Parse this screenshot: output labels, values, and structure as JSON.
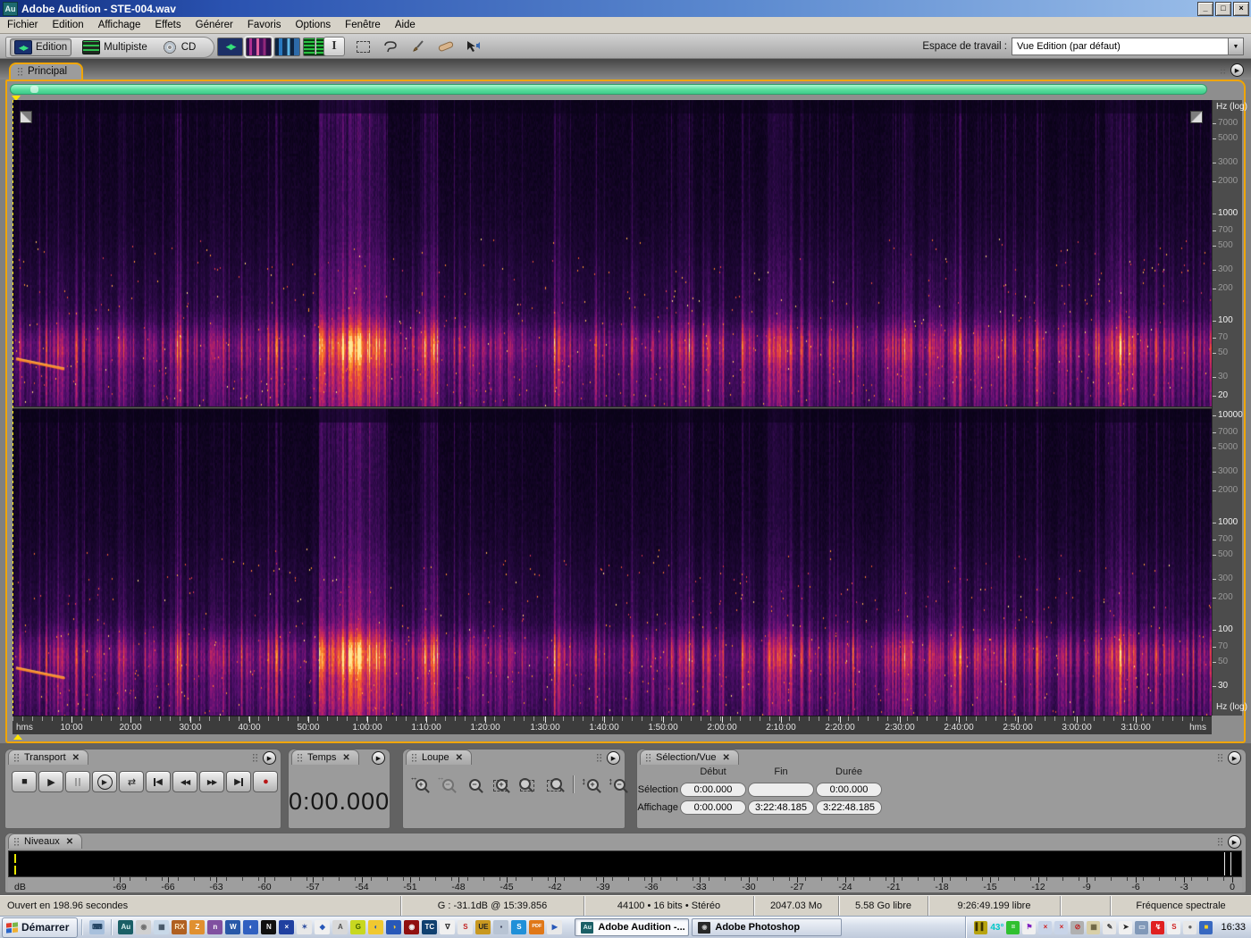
{
  "window": {
    "title": "Adobe Audition - STE-004.wav",
    "app_icon": "Au",
    "controls": {
      "minimize": "_",
      "restore": "□",
      "close": "×"
    }
  },
  "menu": {
    "items": [
      "Fichier",
      "Edition",
      "Affichage",
      "Effets",
      "Générer",
      "Favoris",
      "Options",
      "Fenêtre",
      "Aide"
    ]
  },
  "toolbar": {
    "modes": [
      {
        "label": "Edition",
        "icon": "edition-view-icon",
        "active": true
      },
      {
        "label": "Multipiste",
        "icon": "multitrack-view-icon",
        "active": false
      },
      {
        "label": "CD",
        "icon": "cd-view-icon",
        "active": false
      }
    ],
    "views": [
      {
        "name": "waveform-view",
        "active": false
      },
      {
        "name": "spectral-view",
        "active": true
      },
      {
        "name": "spectral-pan-view",
        "active": false
      },
      {
        "name": "phase-view",
        "active": false
      }
    ],
    "tools": [
      {
        "name": "time-selection-tool",
        "active": true
      },
      {
        "name": "marquee-selection-tool",
        "active": false
      },
      {
        "name": "lasso-selection-tool",
        "active": false
      },
      {
        "name": "effects-paintbrush-tool",
        "active": false
      },
      {
        "name": "spot-healing-brush-tool",
        "active": false
      },
      {
        "name": "scrub-tool",
        "active": false
      }
    ],
    "workspace_label": "Espace de travail :",
    "workspace_value": "Vue Edition (par défaut)",
    "workspace_dropdown_icon": "▼"
  },
  "tab": {
    "label": "Principal"
  },
  "spectro": {
    "freq_axis": {
      "unit_label": "Hz (log)",
      "ch1_ticks": [
        {
          "label": "7000",
          "f": 7000,
          "bold": false
        },
        {
          "label": "5000",
          "f": 5000,
          "bold": false
        },
        {
          "label": "3000",
          "f": 3000,
          "bold": false
        },
        {
          "label": "2000",
          "f": 2000,
          "bold": false
        },
        {
          "label": "1000",
          "f": 1000,
          "bold": true
        },
        {
          "label": "700",
          "f": 700,
          "bold": false
        },
        {
          "label": "500",
          "f": 500,
          "bold": false
        },
        {
          "label": "300",
          "f": 300,
          "bold": false
        },
        {
          "label": "200",
          "f": 200,
          "bold": false
        },
        {
          "label": "100",
          "f": 100,
          "bold": true
        },
        {
          "label": "70",
          "f": 70,
          "bold": false
        },
        {
          "label": "50",
          "f": 50,
          "bold": false
        },
        {
          "label": "30",
          "f": 30,
          "bold": false
        },
        {
          "label": "20",
          "f": 20,
          "bold": true
        }
      ],
      "ch2_ticks": [
        {
          "label": "10000",
          "f": 10000,
          "bold": true
        },
        {
          "label": "7000",
          "f": 7000,
          "bold": false
        },
        {
          "label": "5000",
          "f": 5000,
          "bold": false
        },
        {
          "label": "3000",
          "f": 3000,
          "bold": false
        },
        {
          "label": "2000",
          "f": 2000,
          "bold": false
        },
        {
          "label": "1000",
          "f": 1000,
          "bold": true
        },
        {
          "label": "700",
          "f": 700,
          "bold": false
        },
        {
          "label": "500",
          "f": 500,
          "bold": false
        },
        {
          "label": "300",
          "f": 300,
          "bold": false
        },
        {
          "label": "200",
          "f": 200,
          "bold": false
        },
        {
          "label": "100",
          "f": 100,
          "bold": true
        },
        {
          "label": "70",
          "f": 70,
          "bold": false
        },
        {
          "label": "50",
          "f": 50,
          "bold": false
        },
        {
          "label": "30",
          "f": 30,
          "bold": true
        }
      ]
    }
  },
  "time_ruler": {
    "left_label": "hms",
    "right_label": "hms",
    "total_seconds": 12168.185,
    "ticks": [
      {
        "label": "10:00",
        "t": 600
      },
      {
        "label": "20:00",
        "t": 1200
      },
      {
        "label": "30:00",
        "t": 1800
      },
      {
        "label": "40:00",
        "t": 2400
      },
      {
        "label": "50:00",
        "t": 3000
      },
      {
        "label": "1:00:00",
        "t": 3600
      },
      {
        "label": "1:10:00",
        "t": 4200
      },
      {
        "label": "1:20:00",
        "t": 4800
      },
      {
        "label": "1:30:00",
        "t": 5400
      },
      {
        "label": "1:40:00",
        "t": 6000
      },
      {
        "label": "1:50:00",
        "t": 6600
      },
      {
        "label": "2:00:00",
        "t": 7200
      },
      {
        "label": "2:10:00",
        "t": 7800
      },
      {
        "label": "2:20:00",
        "t": 8400
      },
      {
        "label": "2:30:00",
        "t": 9000
      },
      {
        "label": "2:40:00",
        "t": 9600
      },
      {
        "label": "2:50:00",
        "t": 10200
      },
      {
        "label": "3:00:00",
        "t": 10800
      },
      {
        "label": "3:10:00",
        "t": 11400
      }
    ]
  },
  "panels": {
    "transport": {
      "title": "Transport",
      "buttons": [
        {
          "name": "stop-button",
          "glyph": "■"
        },
        {
          "name": "play-button",
          "glyph": "▶"
        },
        {
          "name": "pause-button",
          "glyph": "bars",
          "disabled": true
        },
        {
          "name": "play-from-cursor-button",
          "glyph": "▶",
          "circle": true
        },
        {
          "name": "loop-play-button",
          "glyph": "⇄"
        },
        {
          "name": "go-to-start-button",
          "glyph": "◀",
          "bar": "left"
        },
        {
          "name": "rewind-button",
          "glyph": "◀◀"
        },
        {
          "name": "fast-forward-button",
          "glyph": "▶▶"
        },
        {
          "name": "go-to-end-button",
          "glyph": "▶",
          "bar": "right"
        },
        {
          "name": "record-button",
          "glyph": "●",
          "record": true
        }
      ]
    },
    "temps": {
      "title": "Temps",
      "value": "0:00.000"
    },
    "loupe": {
      "title": "Loupe",
      "buttons": [
        {
          "name": "zoom-in-horizontal-button",
          "type": "in-h"
        },
        {
          "name": "zoom-out-horizontal-button",
          "type": "out-h",
          "disabled": true
        },
        {
          "name": "zoom-out-full-button",
          "type": "out-full"
        },
        {
          "name": "zoom-to-selection-button",
          "type": "sel"
        },
        {
          "name": "zoom-selection-left-button",
          "type": "sel-left"
        },
        {
          "name": "zoom-selection-right-button",
          "type": "sel-right"
        },
        {
          "name": "divider",
          "type": "divider"
        },
        {
          "name": "zoom-in-vertical-button",
          "type": "in-v"
        },
        {
          "name": "zoom-out-vertical-button",
          "type": "out-v"
        }
      ]
    },
    "selection": {
      "title": "Sélection/Vue",
      "headers": [
        "Début",
        "Fin",
        "Durée"
      ],
      "rows": [
        {
          "label": "Sélection",
          "values": [
            "0:00.000",
            "",
            "0:00.000"
          ]
        },
        {
          "label": "Affichage",
          "values": [
            "0:00.000",
            "3:22:48.185",
            "3:22:48.185"
          ]
        }
      ]
    }
  },
  "niveaux": {
    "title": "Niveaux",
    "unit": "dB",
    "db_ticks": [
      -69,
      -66,
      -63,
      -60,
      -57,
      -54,
      -51,
      -48,
      -45,
      -42,
      -39,
      -36,
      -33,
      -30,
      -27,
      -24,
      -21,
      -18,
      -15,
      -12,
      -9,
      -6,
      -3,
      0
    ]
  },
  "status": {
    "segments": [
      "Ouvert en 198.96 secondes",
      "G : -31.1dB @  15:39.856",
      "44100 • 16 bits • Stéréo",
      "2047.03 Mo",
      "5.58 Go libre",
      "9:26:49.199 libre",
      "",
      "Fréquence spectrale"
    ]
  },
  "taskbar": {
    "start_label": "Démarrer",
    "quicklaunch": [
      {
        "name": "quicklaunch-keyboard-icon",
        "glyph": "⌨",
        "bg": "#a8c0dc",
        "fg": "#204060"
      },
      {
        "name": "separator",
        "sep": true
      },
      {
        "name": "quicklaunch-audition-icon",
        "glyph": "Au",
        "bg": "#1a5f66",
        "fg": "#d8f0f0"
      },
      {
        "name": "quicklaunch-sphere-icon",
        "glyph": "◉",
        "bg": "#d0d0d0",
        "fg": "#707070"
      },
      {
        "name": "quicklaunch-calculator-icon",
        "glyph": "▦",
        "bg": "#c8d8e8",
        "fg": "#405060"
      },
      {
        "name": "quicklaunch-rx-icon",
        "glyph": "RX",
        "bg": "#b06020",
        "fg": "#ffe8c0"
      },
      {
        "name": "quicklaunch-folder-z-icon",
        "glyph": "Z",
        "bg": "#e09030",
        "fg": "#ffffff"
      },
      {
        "name": "quicklaunch-onenote-icon",
        "glyph": "n",
        "bg": "#8050a0",
        "fg": "#ffffff"
      },
      {
        "name": "quicklaunch-word-icon",
        "glyph": "W",
        "bg": "#2858a8",
        "fg": "#ffffff"
      },
      {
        "name": "quicklaunch-planet-icon",
        "glyph": "◐",
        "bg": "#3060c0",
        "fg": "#ffffff"
      },
      {
        "name": "quicklaunch-n-icon",
        "glyph": "N",
        "bg": "#101010",
        "fg": "#f0f0f0"
      },
      {
        "name": "quicklaunch-x-tool-icon",
        "glyph": "×",
        "bg": "#2040a0",
        "fg": "#ffffff"
      },
      {
        "name": "quicklaunch-star-icon",
        "glyph": "✶",
        "bg": "#e8e8e8",
        "fg": "#3050a0"
      },
      {
        "name": "quicklaunch-diamond-icon",
        "glyph": "◆",
        "bg": "#f0f0f0",
        "fg": "#2858b8"
      },
      {
        "name": "quicklaunch-a-icon",
        "glyph": "A",
        "bg": "#d8d8d8",
        "fg": "#505050"
      },
      {
        "name": "quicklaunch-green-icon",
        "glyph": "G",
        "bg": "#c8d820",
        "fg": "#406000"
      },
      {
        "name": "quicklaunch-globe1-icon",
        "glyph": "◐",
        "bg": "#f0c830",
        "fg": "#2858b8"
      },
      {
        "name": "quicklaunch-globe2-icon",
        "glyph": "◑",
        "bg": "#2858b8",
        "fg": "#f0c830"
      },
      {
        "name": "quicklaunch-eye-icon",
        "glyph": "◉",
        "bg": "#901010",
        "fg": "#f0f0f0"
      },
      {
        "name": "quicklaunch-tc-icon",
        "glyph": "TC",
        "bg": "#104070",
        "fg": "#ffffff"
      },
      {
        "name": "quicklaunch-compass-icon",
        "glyph": "∇",
        "bg": "#f0f0f0",
        "fg": "#202020"
      },
      {
        "name": "quicklaunch-sbp-icon",
        "glyph": "S",
        "bg": "#e8e8e8",
        "fg": "#c02020"
      },
      {
        "name": "quicklaunch-ue-icon",
        "glyph": "UE",
        "bg": "#c89820",
        "fg": "#202020"
      },
      {
        "name": "quicklaunch-widget-icon",
        "glyph": "▪",
        "bg": "#b8c4d4",
        "fg": "#404860"
      },
      {
        "name": "quicklaunch-s-swirl-icon",
        "glyph": "S",
        "bg": "#2090d8",
        "fg": "#ffffff"
      },
      {
        "name": "quicklaunch-pdf-icon",
        "glyph": "PDF",
        "bg": "#e07818",
        "fg": "#ffffff",
        "small": true
      },
      {
        "name": "quicklaunch-media-player-icon",
        "glyph": "▶",
        "bg": "#e8e8e8",
        "fg": "#2858b8"
      }
    ],
    "windows": [
      {
        "label": "Adobe Audition -...",
        "active": true,
        "icon_glyph": "Au",
        "icon_bg": "#1a5f66",
        "icon_fg": "#d8f0f0"
      },
      {
        "label": "Adobe Photoshop",
        "active": false,
        "icon_glyph": "◉",
        "icon_bg": "#282828",
        "icon_fg": "#c0c0c0"
      }
    ],
    "tray": [
      {
        "name": "tray-meter-icon",
        "glyph": "▍▍",
        "bg": "#b8a410",
        "fg": "#3a3000"
      },
      {
        "name": "tray-temperature",
        "text": "43°"
      },
      {
        "name": "tray-battery-icon",
        "glyph": "=",
        "bg": "#30c030",
        "fg": "#ffffff"
      },
      {
        "name": "tray-flag-icon",
        "glyph": "⚑",
        "bg": "#f0f0f0",
        "fg": "#8020c0"
      },
      {
        "name": "tray-network-x1-icon",
        "glyph": "×",
        "bg": "#c8d4e8",
        "fg": "#d02020"
      },
      {
        "name": "tray-network-x2-icon",
        "glyph": "×",
        "bg": "#c8d4e8",
        "fg": "#d02020"
      },
      {
        "name": "tray-blocked-icon",
        "glyph": "⊘",
        "bg": "#b0b0b0",
        "fg": "#c02020"
      },
      {
        "name": "tray-disk-icon",
        "glyph": "▦",
        "bg": "#d8cfa8",
        "fg": "#686040"
      },
      {
        "name": "tray-stylus-icon",
        "glyph": "✎",
        "bg": "#e8e8e8",
        "fg": "#404040"
      },
      {
        "name": "tray-cursor-icon",
        "glyph": "➤",
        "bg": "#f0f0f0",
        "fg": "#202020"
      },
      {
        "name": "tray-monitor-icon",
        "glyph": "▭",
        "bg": "#8098b8",
        "fg": "#e0e8f0"
      },
      {
        "name": "tray-lightning-icon",
        "glyph": "↯",
        "bg": "#e02020",
        "fg": "#ffffff"
      },
      {
        "name": "tray-s-red-icon",
        "glyph": "S",
        "bg": "#f0f0f0",
        "fg": "#d02020"
      },
      {
        "name": "tray-mouse-icon",
        "glyph": "●",
        "bg": "#e8e8e8",
        "fg": "#606060"
      },
      {
        "name": "tray-folder-icon",
        "glyph": "■",
        "bg": "#3868c0",
        "fg": "#ffd020"
      }
    ],
    "clock": "16:33"
  }
}
